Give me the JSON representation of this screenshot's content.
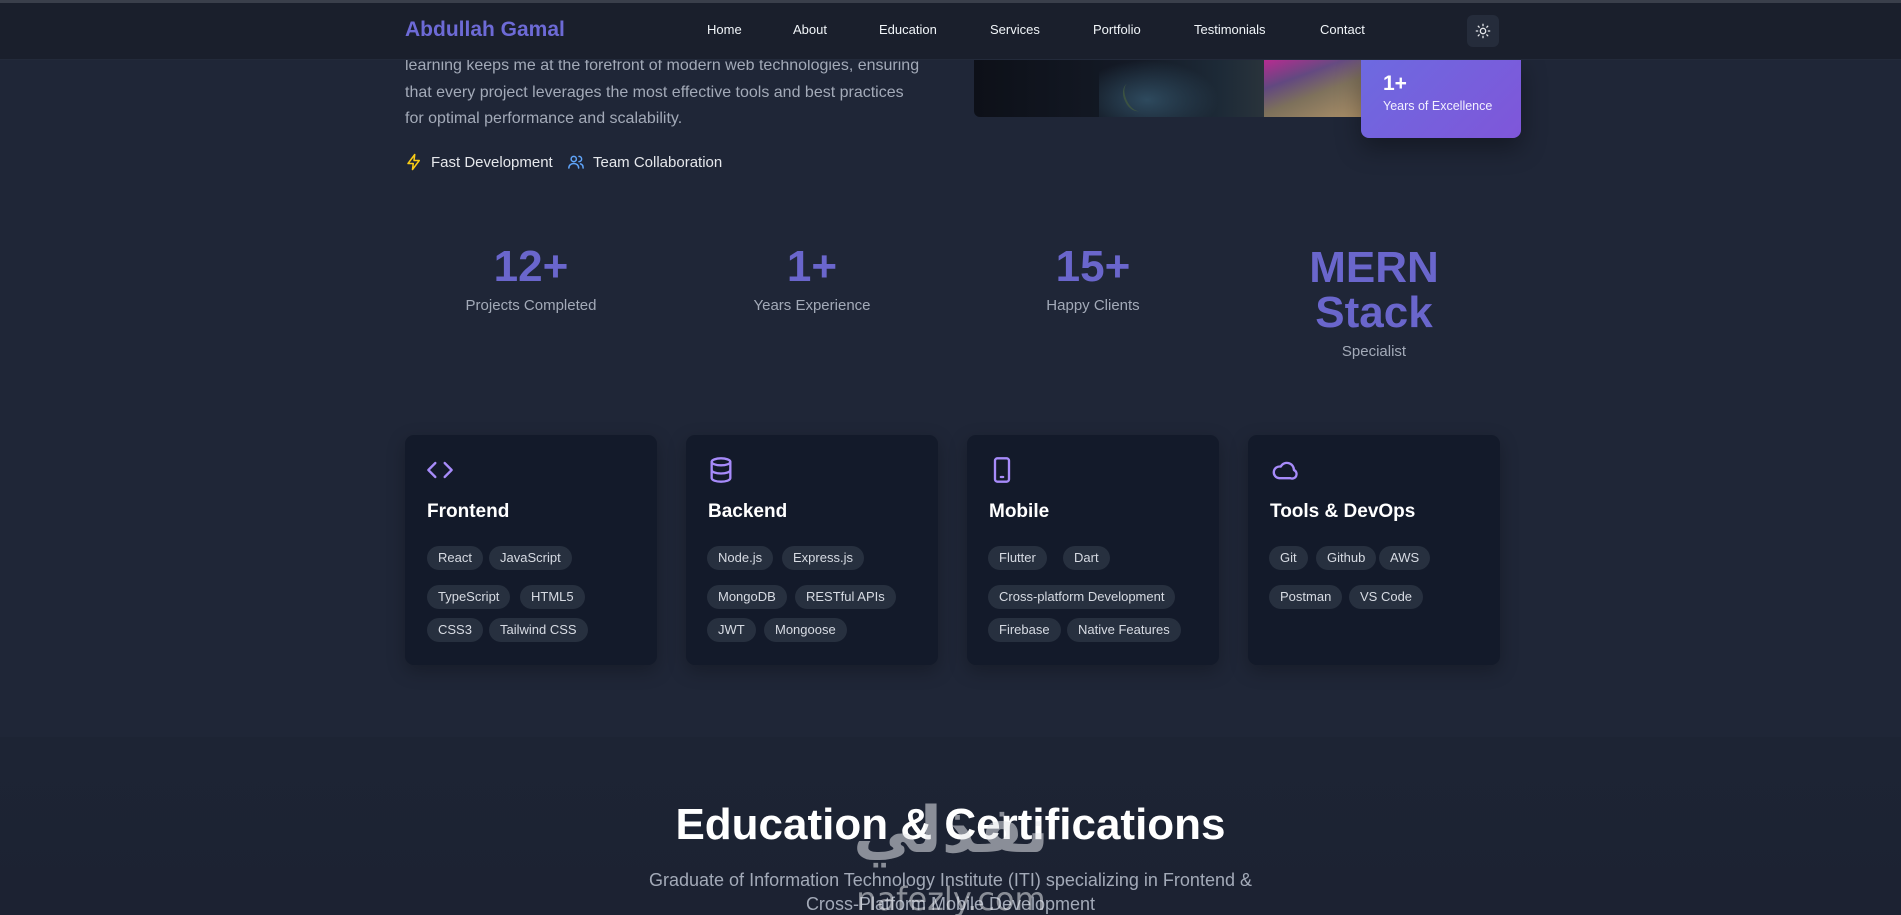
{
  "navbar": {
    "brand": "Abdullah Gamal",
    "links": [
      "Home",
      "About",
      "Education",
      "Services",
      "Portfolio",
      "Testimonials",
      "Contact"
    ],
    "theme_icon": "sun-icon"
  },
  "about": {
    "text": "learning keeps me at the forefront of modern web technologies, ensuring that every project leverages the most effective tools and best practices for optimal performance and scalability.",
    "features": [
      {
        "icon": "lightning-icon",
        "label": "Fast Development"
      },
      {
        "icon": "users-icon",
        "label": "Team Collaboration"
      }
    ],
    "excellence_badge": {
      "value": "1+",
      "label": "Years of Excellence"
    }
  },
  "stats": [
    {
      "value": "12+",
      "label": "Projects Completed"
    },
    {
      "value": "1+",
      "label": "Years Experience"
    },
    {
      "value": "15+",
      "label": "Happy Clients"
    },
    {
      "value": "MERN Stack",
      "label": "Specialist"
    }
  ],
  "skills": [
    {
      "icon": "code-icon",
      "title": "Frontend",
      "tags": [
        "React",
        "JavaScript",
        "TypeScript",
        "HTML5",
        "CSS3",
        "Tailwind CSS"
      ]
    },
    {
      "icon": "database-icon",
      "title": "Backend",
      "tags": [
        "Node.js",
        "Express.js",
        "MongoDB",
        "RESTful APIs",
        "JWT",
        "Mongoose"
      ]
    },
    {
      "icon": "phone-icon",
      "title": "Mobile",
      "tags": [
        "Flutter",
        "Dart",
        "Cross-platform Development",
        "Firebase",
        "Native Features"
      ]
    },
    {
      "icon": "cloud-icon",
      "title": "Tools & DevOps",
      "tags": [
        "Git",
        "Github",
        "AWS",
        "Postman",
        "VS Code"
      ]
    }
  ],
  "education": {
    "title": "Education & Certifications",
    "subtitle_line1": "Graduate of Information Technology Institute (ITI) specializing in Frontend &",
    "subtitle_line2": "Cross-Platform Mobile Development"
  },
  "watermark": {
    "arabic": "نفذلي",
    "latin": "nafezly.com"
  },
  "colors": {
    "accent": "#6a66cc",
    "card_bg": "#131a2a",
    "page_bg": "#1f2637",
    "icon_purple": "#a78bfa"
  }
}
